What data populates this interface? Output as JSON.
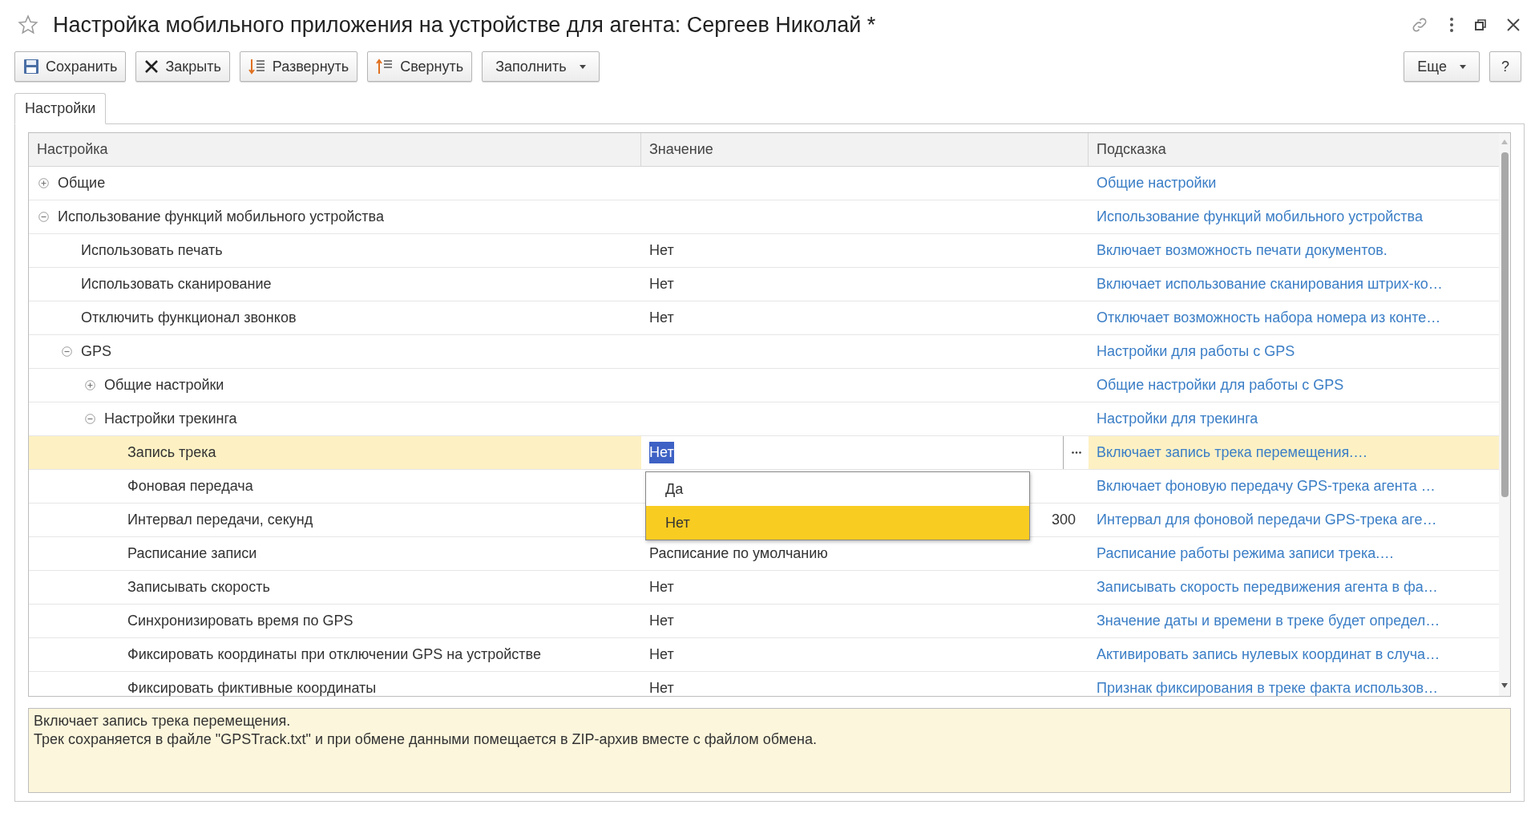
{
  "window": {
    "title": "Настройка мобильного приложения на устройстве для агента: Сергеев Николай *"
  },
  "toolbar": {
    "buttons": [
      {
        "label": "Сохранить"
      },
      {
        "label": "Закрыть"
      },
      {
        "label": "Развернуть"
      },
      {
        "label": "Свернуть"
      },
      {
        "label": "Заполнить"
      }
    ],
    "right_buttons": [
      {
        "label": "Еще"
      },
      {
        "label": "?"
      }
    ]
  },
  "tabs": [
    {
      "label": "Настройки",
      "selected": true
    }
  ],
  "table": {
    "columns": [
      "Настройка",
      "Значение",
      "Подсказка"
    ],
    "rows": [
      {
        "kind": "group",
        "label": "Общие",
        "expanded": false,
        "hint": "Общие настройки",
        "selected": false
      },
      {
        "kind": "group",
        "label": "Использование функций мобильного устройства",
        "expanded": true,
        "hint": "Использование функций мобильного устройства",
        "selected": false,
        "children": [
          {
            "kind": "text",
            "label": "Использовать печать",
            "value": "Нет",
            "hint": "Включает возможность печати документов.",
            "selected": false
          },
          {
            "kind": "text",
            "label": "Использовать сканирование",
            "value": "Нет",
            "hint": "Включает использование сканирования штрих-ко…",
            "selected": false
          },
          {
            "kind": "text",
            "label": "Отключить функционал звонков",
            "value": "Нет",
            "hint": "Отключает возможность набора номера из конте…",
            "selected": false
          },
          {
            "kind": "group",
            "label": "GPS",
            "expanded": true,
            "hint": "Настройки для работы с GPS",
            "selected": false,
            "children": [
              {
                "kind": "group",
                "label": "Общие настройки",
                "expanded": false,
                "hint": "Общие настройки для работы с GPS",
                "selected": false
              },
              {
                "kind": "group",
                "label": "Настройки трекинга",
                "expanded": true,
                "hint": "Настройки для трекинга",
                "selected": false,
                "children": [
                  {
                    "kind": "text",
                    "label": "Запись трека",
                    "value": "Нет",
                    "hint": "Включает запись трека перемещения.…",
                    "selected": true,
                    "dropdown": {
                      "options": [
                        {
                          "label": "Да",
                          "selected": false
                        },
                        {
                          "label": "Нет",
                          "selected": true
                        }
                      ]
                    }
                  },
                  {
                    "kind": "text",
                    "label": "Фоновая передача",
                    "hint": "Включает фоновую передачу GPS-трека агента …",
                    "selected": false
                  },
                  {
                    "kind": "number",
                    "label": "Интервал передачи, секунд",
                    "value": "300",
                    "hint": "Интервал для фоновой передачи GPS-трека аге…",
                    "selected": false
                  },
                  {
                    "kind": "text",
                    "label": "Расписание записи",
                    "value": "Расписание по умолчанию",
                    "hint": "Расписание работы режима записи трека.…",
                    "selected": false
                  },
                  {
                    "kind": "text",
                    "label": "Записывать скорость",
                    "value": "Нет",
                    "hint": "Записывать скорость передвижения агента в фа…",
                    "selected": false
                  },
                  {
                    "kind": "text",
                    "label": "Синхронизировать время по GPS",
                    "value": "Нет",
                    "hint": "Значение даты и времени в треке будет определ…",
                    "selected": false
                  },
                  {
                    "kind": "text",
                    "label": "Фиксировать координаты при отключении GPS на устройстве",
                    "value": "Нет",
                    "hint": "Активировать запись нулевых координат в случа…",
                    "selected": false
                  },
                  {
                    "kind": "text",
                    "label": "Фиксировать фиктивные координаты",
                    "value": "Нет",
                    "hint": "Признак фиксирования в треке факта использов…",
                    "selected": false
                  }
                ]
              }
            ]
          }
        ]
      }
    ]
  },
  "description": [
    "Включает запись трека перемещения.",
    "Трек сохраняется в файле \"GPSTrack.txt\" и при обмене данными помещается в ZIP-архив вместе с файлом обмена."
  ]
}
